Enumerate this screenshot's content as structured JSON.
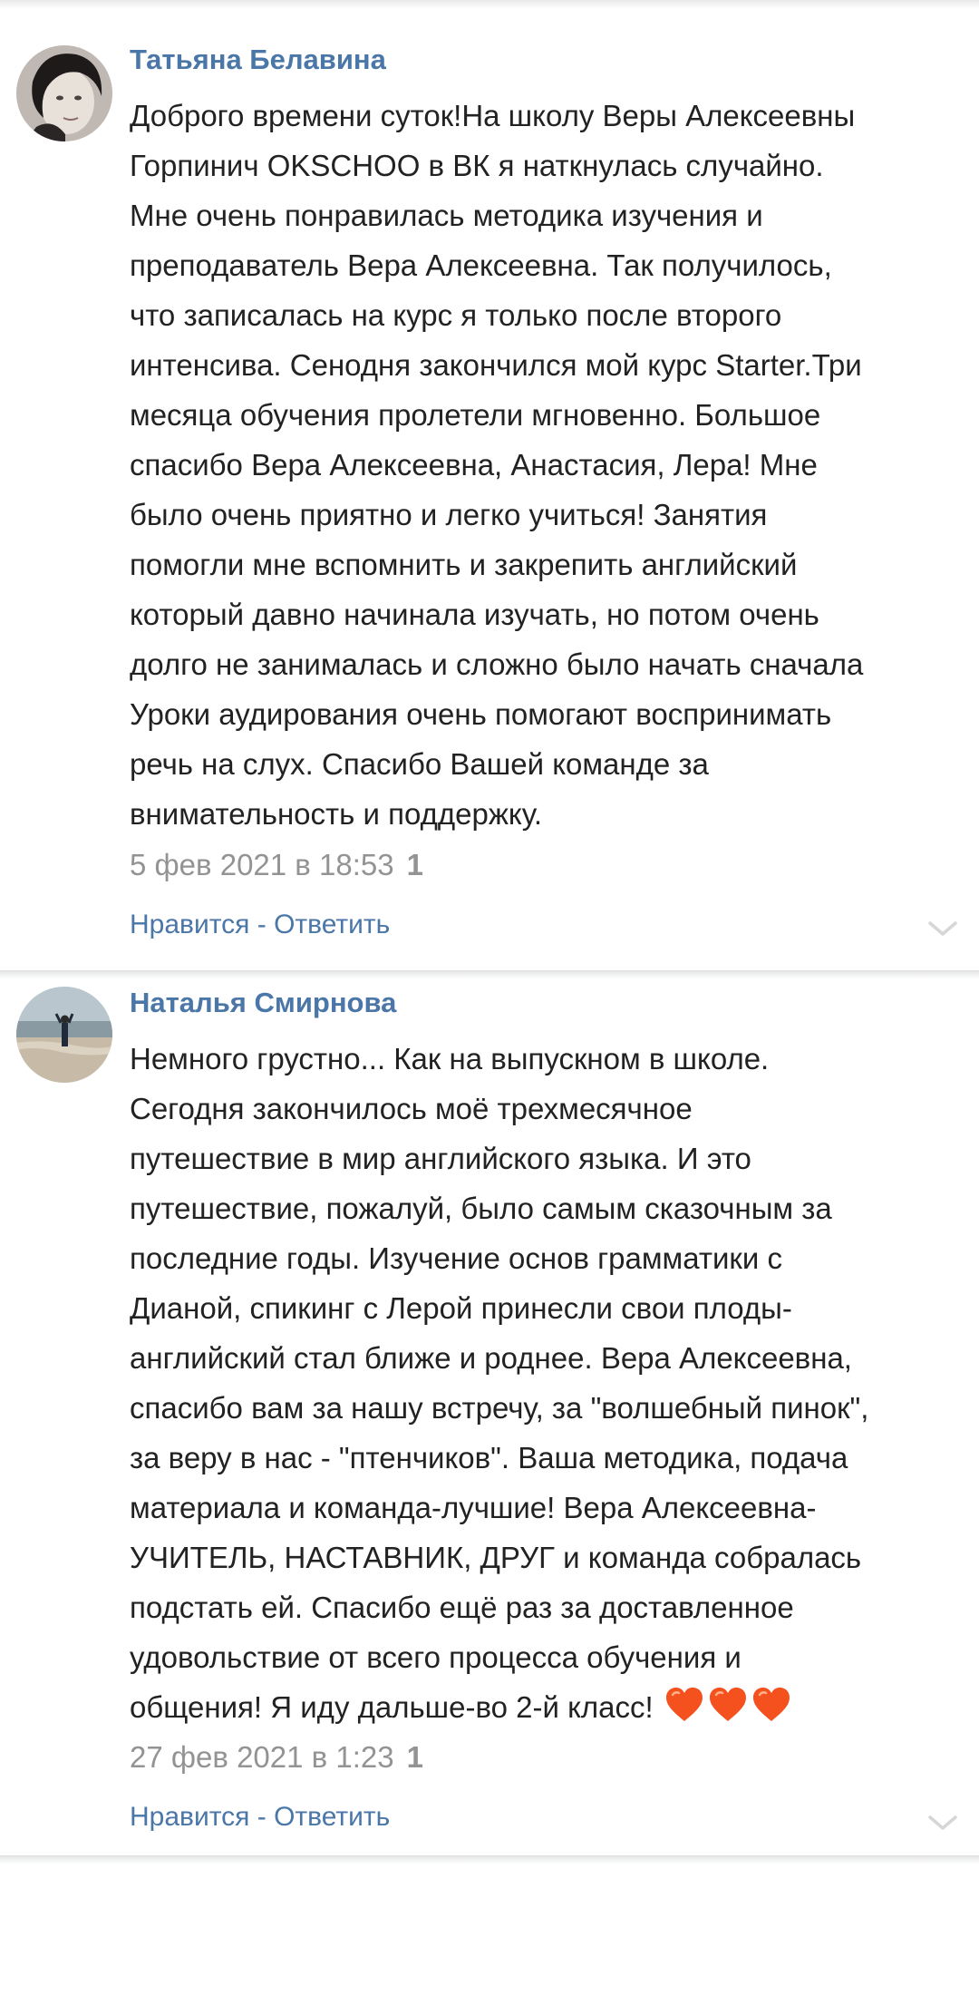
{
  "comments": [
    {
      "author": "Татьяна Белавина",
      "text_lines": [
        "Доброго времени суток!На школу Веры Алексеевны",
        "Горпинич OKSCHOO в ВК я наткнулась случайно.",
        "Мне очень понравилась методика изучения и",
        "преподаватель Вера Алексеевна. Так получилось,",
        "что записалась на курс я только после второго",
        "интенсива. Сенодня закончился мой курс Starter.Три",
        "месяца обучения пролетели мгновенно. Большое",
        "спасибо Вера Алексеевна, Анастасия, Лера! Мне",
        "было очень приятно и легко учиться! Занятия",
        "помогли мне вспомнить и закрепить английский",
        "который давно начинала изучать, но потом очень",
        "долго не занималась и сложно было начать сначала",
        "Уроки аудирования очень помогают воспринимать",
        "речь на слух. Спасибо Вашей команде за",
        "внимательность и поддержку."
      ],
      "date": "5 фев 2021 в 18:53",
      "likes": "1",
      "like_label": "Нравится",
      "separator": " - ",
      "reply_label": "Ответить"
    },
    {
      "author": "Наталья Смирнова",
      "text_lines": [
        "Немного грустно... Как на выпускном в школе.",
        "Сегодня закончилось моё трехмесячное",
        "путешествие в мир английского языка. И это",
        "путешествие, пожалуй, было самым сказочным за",
        "последние годы. Изучение основ грамматики с",
        "Дианой, спикинг с Лерой принесли свои плоды-",
        "английский стал ближе и роднее. Вера Алексеевна,",
        "спасибо вам за нашу встречу, за \"волшебный пинок\",",
        "за веру в нас - \"птенчиков\". Ваша методика, подача",
        "материала и команда-лучшие! Вера Алексеевна-",
        "УЧИТЕЛЬ, НАСТАВНИК, ДРУГ и команда собралась",
        "подстать ей. Спасибо ещё раз за доставленное",
        "удовольствие от всего процесса обучения и",
        "общения! Я иду дальше-во 2-й класс!"
      ],
      "emoji_icons": [
        "orange-heart-icon",
        "orange-heart-icon",
        "orange-heart-icon"
      ],
      "date": "27 фев 2021 в 1:23",
      "likes": "1",
      "like_label": "Нравится",
      "separator": " - ",
      "reply_label": "Ответить"
    }
  ],
  "colors": {
    "link": "#4a76a8",
    "text": "#222222",
    "meta": "#939393",
    "heart": "#f4511e"
  }
}
